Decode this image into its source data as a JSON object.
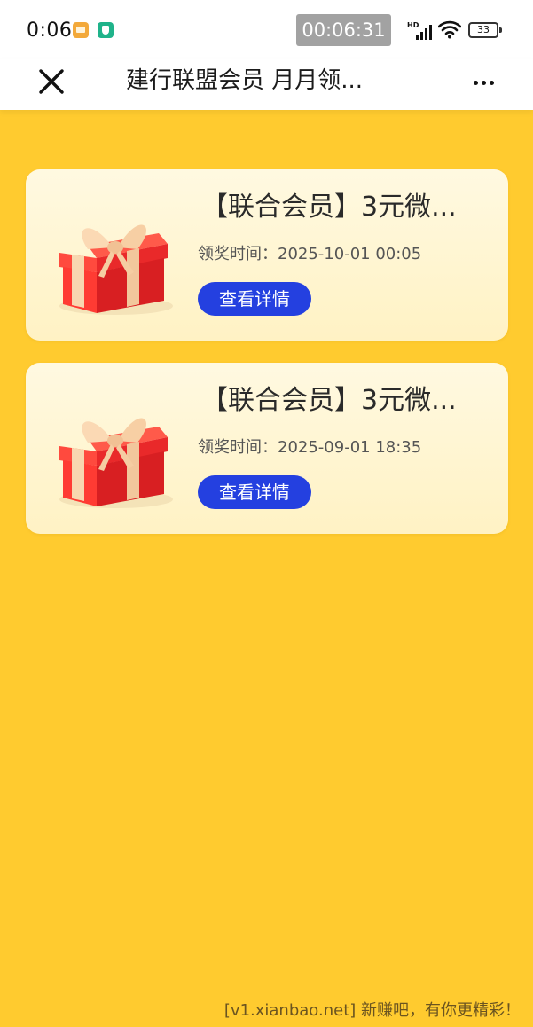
{
  "status_bar": {
    "time": "0:06",
    "recording_timer": "00:06:31",
    "network_label": "HD",
    "battery_level": "33",
    "icons": [
      "message-notification-icon",
      "shield-notification-icon",
      "signal-icon",
      "wifi-icon",
      "battery-icon"
    ]
  },
  "nav": {
    "title": "建行联盟会员 月月领...",
    "close_icon": "close-icon",
    "more_icon": "more-icon"
  },
  "records": [
    {
      "title": "【联合会员】3元微...",
      "time": "领奖时间：2025-10-01 00:05",
      "button_label": "查看详情",
      "icon": "gift-box-icon"
    },
    {
      "title": "【联合会员】3元微...",
      "time": "领奖时间：2025-09-01 18:35",
      "button_label": "查看详情",
      "icon": "gift-box-icon"
    }
  ],
  "footer": {
    "watermark": "[v1.xianbao.net] 新赚吧，有你更精彩！"
  },
  "colors": {
    "page_background": "#ffcb2f",
    "button": "#2440e0",
    "gift_box": "#e9292a",
    "gift_ribbon": "#f7d3a8"
  }
}
